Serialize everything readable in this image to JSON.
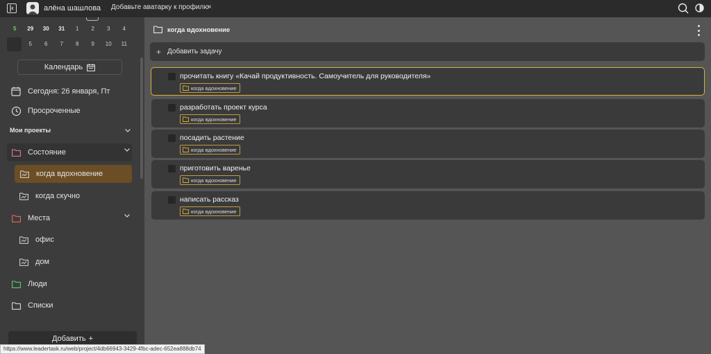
{
  "topbar": {
    "username": "алёна шашлова",
    "notice": "Добавьте аватарку к профилю",
    "notice_close": "×"
  },
  "calendar": {
    "row1": [
      "5",
      "29",
      "30",
      "31",
      "1",
      "2",
      "3",
      "4"
    ],
    "row2": [
      "",
      "5",
      "6",
      "7",
      "8",
      "9",
      "10",
      "11"
    ],
    "button_label": "Календарь"
  },
  "sidebar": {
    "today": "Сегодня: 26 января, Пт",
    "overdue": "Просроченные",
    "my_projects": "Мои проекты",
    "items": [
      {
        "label": "Состояние"
      },
      {
        "label": "когда вдохновение"
      },
      {
        "label": "когда скучно"
      },
      {
        "label": "Места"
      },
      {
        "label": "офис"
      },
      {
        "label": "дом"
      },
      {
        "label": "Люди"
      },
      {
        "label": "Списки"
      }
    ],
    "add_label": "Добавить",
    "add_icon": "+"
  },
  "main": {
    "title": "когда вдохновение",
    "add_task": "Добавить задачу",
    "tasks": [
      {
        "title": "прочитать книгу «Качай продуктивность. Самоучитель для руководителя»",
        "tag": "когда вдохновение"
      },
      {
        "title": "разработать проект курса",
        "tag": "когда вдохновение"
      },
      {
        "title": "посадить растение",
        "tag": "когда вдохновение"
      },
      {
        "title": "приготовить варенье",
        "tag": "когда вдохновение"
      },
      {
        "title": "написать рассказ",
        "tag": "когда вдохновение"
      }
    ]
  },
  "status_url": "https://www.leadertask.ru/web/project/4db66943-3429-4fbc-adec-652ea888db74",
  "colors": {
    "accent": "#d8b23a",
    "active_item": "#6b4e25",
    "folder_pink": "#e07a9a",
    "folder_red": "#e06a5a",
    "folder_green": "#5fc77a",
    "today_green": "#6fcf6f"
  }
}
